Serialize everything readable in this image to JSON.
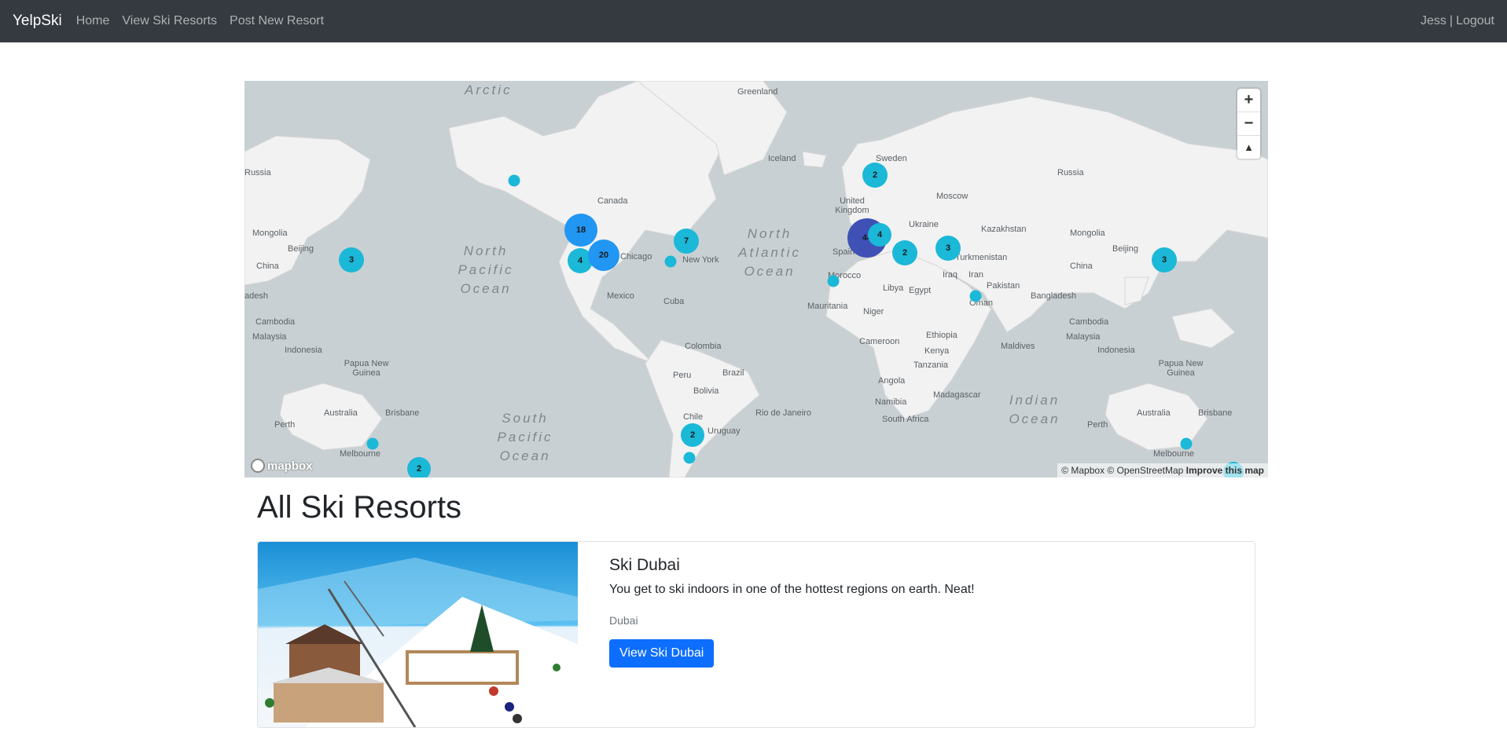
{
  "navbar": {
    "brand": "YelpSki",
    "links": [
      "Home",
      "View Ski Resorts",
      "Post New Resort"
    ],
    "user": "Jess",
    "separator": "|",
    "logout": "Logout"
  },
  "map": {
    "oceans": [
      "Arctic",
      "North Pacific Ocean",
      "North Atlantic Ocean",
      "South Pacific Ocean",
      "Indian Ocean"
    ],
    "places": {
      "greenland": "Greenland",
      "iceland": "Iceland",
      "sweden": "Sweden",
      "russia_left": "Russia",
      "russia_right": "Russia",
      "canada": "Canada",
      "uk": "United Kingdom",
      "moscow": "Moscow",
      "ukraine": "Ukraine",
      "kazakhstan": "Kazakhstan",
      "mongolia_left": "Mongolia",
      "mongolia_right": "Mongolia",
      "beijing_left": "Beijing",
      "beijing_right": "Beijing",
      "china_left": "China",
      "china_right": "China",
      "chicago": "Chicago",
      "new_york": "New York",
      "spain": "Spain",
      "turkmenistan": "Turkmenistan",
      "iraq": "Iraq",
      "iran": "Iran",
      "pakistan": "Pakistan",
      "morocco": "Morocco",
      "libya": "Libya",
      "egypt": "Egypt",
      "mexico": "Mexico",
      "cuba": "Cuba",
      "bangladesh": "Bangladesh",
      "mauritania": "Mauritania",
      "niger": "Niger",
      "oman": "Oman",
      "cambodia_left": "Cambodia",
      "cambodia_right": "Cambodia",
      "malaysia_left": "Malaysia",
      "malaysia_right": "Malaysia",
      "indonesia_left": "Indonesia",
      "indonesia_right": "Indonesia",
      "desh": "adesh",
      "colombia": "Colombia",
      "ethiopia": "Ethiopia",
      "maldives": "Maldives",
      "cameroon": "Cameroon",
      "kenya": "Kenya",
      "peru": "Peru",
      "brazil": "Brazil",
      "tanzania": "Tanzania",
      "png_left": "Papua New Guinea",
      "png_right": "Papua New Guinea",
      "bolivia": "Bolivia",
      "angola": "Angola",
      "madagascar": "Madagascar",
      "australia_left": "Australia",
      "australia_right": "Australia",
      "brisbane_left": "Brisbane",
      "brisbane_right": "Brisbane",
      "perth_left": "Perth",
      "perth_right": "Perth",
      "namibia": "Namibia",
      "chile": "Chile",
      "rio": "Rio de Janeiro",
      "south_africa": "South Africa",
      "uruguay": "Uruguay",
      "melbourne_left": "Melbourne",
      "melbourne_right": "Melbourne"
    },
    "clusters": [
      "3",
      "18",
      "4",
      "20",
      "7",
      "2",
      "44",
      "4",
      "2",
      "3",
      "3",
      "2",
      "2"
    ],
    "controls": {
      "zoom_in": "+",
      "zoom_out": "−",
      "compass": "▲"
    },
    "logo": "mapbox",
    "attribution": "© Mapbox © OpenStreetMap",
    "improve": "Improve this map",
    "colors": {
      "small": "#1bb8d8",
      "medium": "#2196f3",
      "large": "#3f51b5"
    }
  },
  "page": {
    "heading": "All Ski Resorts"
  },
  "resort": {
    "title": "Ski Dubai",
    "description": "You get to ski indoors in one of the hottest regions on earth. Neat!",
    "location": "Dubai",
    "button": "View Ski Dubai"
  }
}
